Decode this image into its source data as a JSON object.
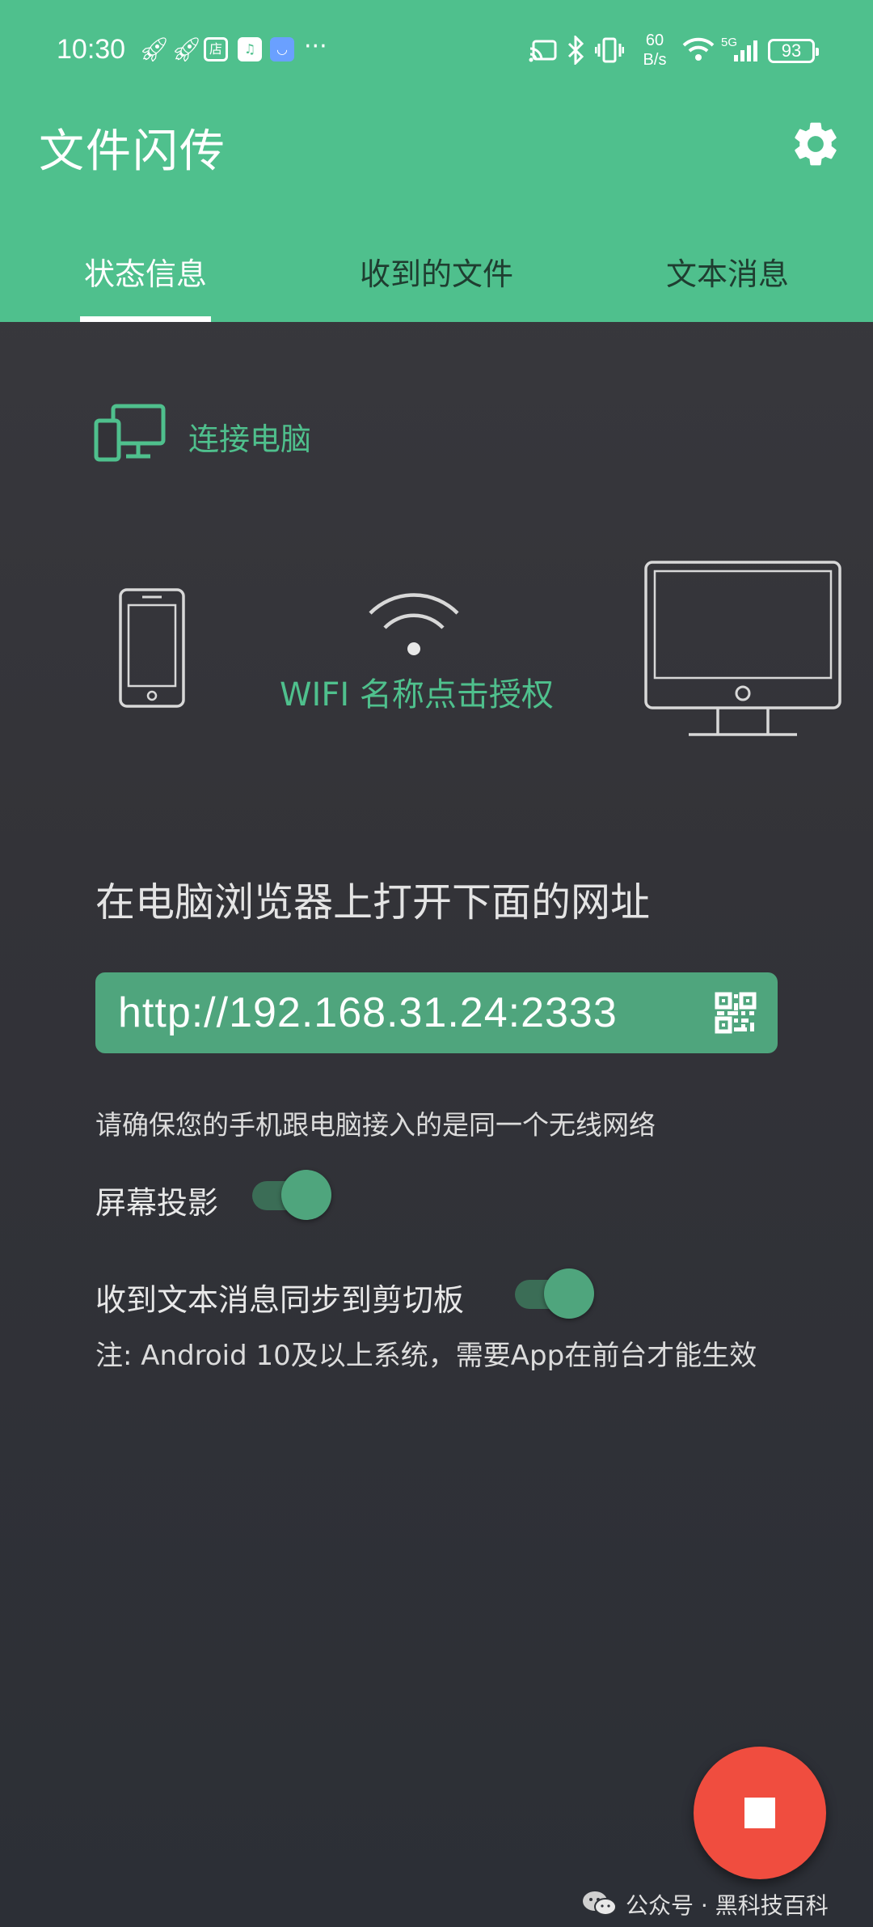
{
  "status_bar": {
    "time": "10:30",
    "net_speed_value": "60",
    "net_speed_unit": "B/s",
    "network_label": "5G",
    "battery": "93",
    "more": "···",
    "icons": [
      "rocket-icon",
      "rocket-icon",
      "store-icon",
      "music-icon",
      "app-icon",
      "cast-icon",
      "bluetooth-icon",
      "vibrate-icon",
      "wifi-icon",
      "signal-icon",
      "battery-icon"
    ]
  },
  "app": {
    "title": "文件闪传"
  },
  "tabs": [
    {
      "label": "状态信息",
      "active": true
    },
    {
      "label": "收到的文件",
      "active": false
    },
    {
      "label": "文本消息",
      "active": false
    }
  ],
  "connect": {
    "label": "连接电脑"
  },
  "wifi": {
    "label": "WIFI 名称点击授权"
  },
  "instructions": {
    "open_title": "在电脑浏览器上打开下面的网址",
    "url": "http://192.168.31.24:2333",
    "same_network_note": "请确保您的手机跟电脑接入的是同一个无线网络"
  },
  "toggles": {
    "screen_projection": {
      "label": "屏幕投影",
      "on": true
    },
    "clipboard_sync": {
      "label": "收到文本消息同步到剪切板",
      "on": true
    }
  },
  "note": "注: Android 10及以上系统，需要App在前台才能生效",
  "watermark": "公众号 · 黑科技百科",
  "colors": {
    "accent": "#4fc08d",
    "url_box": "#4fa57d",
    "fab": "#f04d3f",
    "background": "#333338"
  }
}
